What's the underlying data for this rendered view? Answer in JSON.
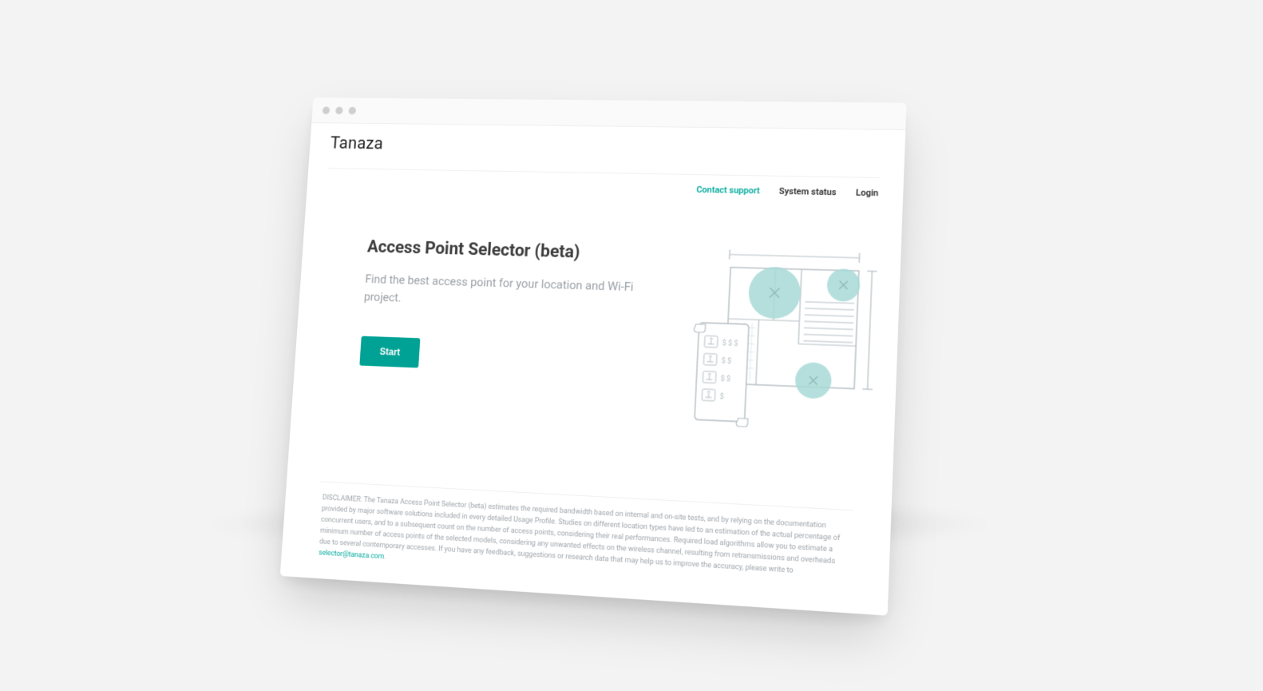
{
  "brand": "Tanaza",
  "nav": {
    "contact": "Contact support",
    "status": "System status",
    "login": "Login"
  },
  "hero": {
    "title": "Access Point Selector (beta)",
    "subtitle": "Find the best access point for your location and Wi-Fi project.",
    "cta": "Start"
  },
  "disclaimer": {
    "body": "DISCLAIMER: The Tanaza Access Point Selector (beta) estimates the required bandwidth based on internal and on-site tests, and by relying on the documentation provided by major software solutions included in every detailed Usage Profile. Studies on different location types have led to an estimation of the actual percentage of concurrent users, and to a subsequent count on the number of access points, considering their real performances. Required load algorithms allow you to estimate a minimum number of access points of the selected models, considering any unwanted effects on the wireless channel, resulting from retransmissions and overheads due to several contemporary accesses. If you have any feedback, suggestions or research data that may help us to improve the accuracy, please write to ",
    "email": "selector@tanaza.com",
    "suffix": "."
  },
  "colors": {
    "accent": "#00a99d",
    "button": "#00a295",
    "illus_stroke": "#b6bfc4",
    "illus_fill": "#a7d9d6"
  }
}
